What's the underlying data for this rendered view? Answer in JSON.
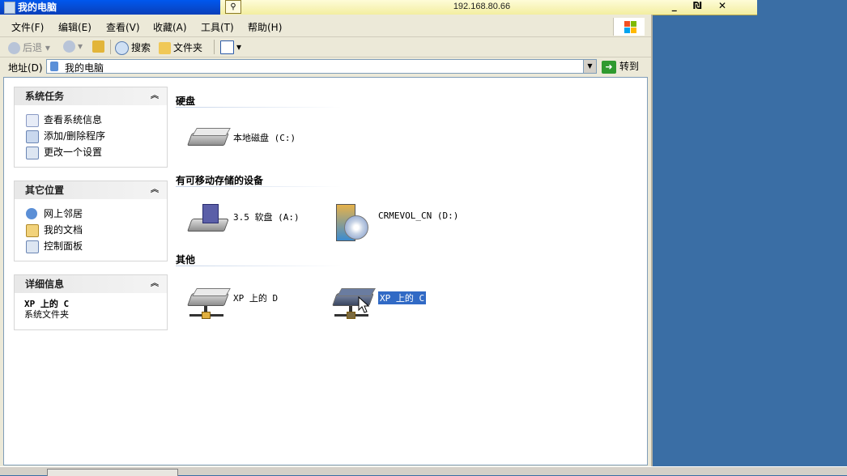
{
  "remote": {
    "host": "192.168.80.66",
    "controls": "_ ₪ ✕"
  },
  "window": {
    "title": "我的电脑"
  },
  "menu": [
    "文件(F)",
    "编辑(E)",
    "查看(V)",
    "收藏(A)",
    "工具(T)",
    "帮助(H)"
  ],
  "toolbar": {
    "back": "后退",
    "search": "搜索",
    "folders": "文件夹"
  },
  "address": {
    "label": "地址(D)",
    "value": "我的电脑",
    "go": "转到"
  },
  "panels": {
    "system_tasks": {
      "title": "系统任务",
      "items": [
        "查看系统信息",
        "添加/删除程序",
        "更改一个设置"
      ]
    },
    "other_places": {
      "title": "其它位置",
      "items": [
        "网上邻居",
        "我的文档",
        "控制面板"
      ]
    },
    "details": {
      "title": "详细信息",
      "name": "XP 上的 C",
      "type": "系统文件夹"
    }
  },
  "groups": {
    "hard_disks": {
      "title": "硬盘",
      "items": [
        "本地磁盘 (C:)"
      ]
    },
    "removable": {
      "title": "有可移动存储的设备",
      "items": [
        "3.5 软盘 (A:)",
        "CRMEVOL_CN (D:)"
      ]
    },
    "other": {
      "title": "其他",
      "items": [
        "XP 上的 D",
        "XP 上的 C"
      ]
    }
  },
  "colors": {
    "title_bar": "#0058ee",
    "desktop": "#3a6ea5",
    "selection": "#316ac5"
  }
}
